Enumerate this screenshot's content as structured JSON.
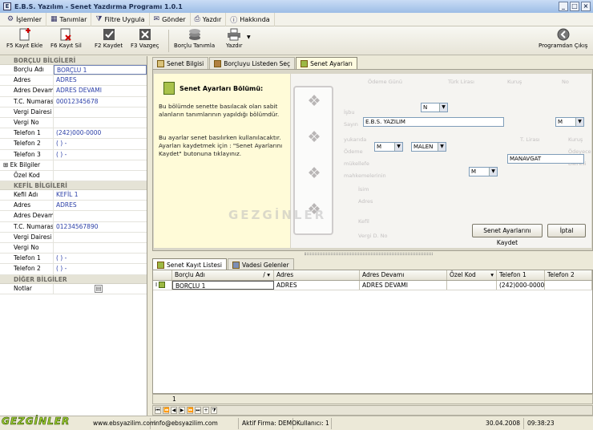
{
  "window": {
    "title": "E.B.S. Yazılım  -  Senet Yazdırma Programı 1.0.1",
    "controls": [
      "_",
      "□",
      "×"
    ]
  },
  "menu": [
    {
      "icon": "gear-icon",
      "label": "İşlemler"
    },
    {
      "icon": "grid-icon",
      "label": "Tanımlar"
    },
    {
      "icon": "filter-icon",
      "label": "Filtre Uygula"
    },
    {
      "icon": "send-icon",
      "label": "Gönder"
    },
    {
      "icon": "printer-icon",
      "label": "Yazdır"
    },
    {
      "icon": "info-icon",
      "label": "Hakkında"
    }
  ],
  "toolbar": {
    "add": "F5 Kayıt Ekle",
    "delete": "F6 Kayıt Sil",
    "save": "F2 Kaydet",
    "cancel": "F3 Vazgeç",
    "borclu": "Borçlu Tanımla",
    "print": "Yazdır",
    "exit": "Programdan Çıkış"
  },
  "left": {
    "borclu_header": "BORÇLU BİLGİLERİ",
    "borclu_rows": [
      {
        "label": "Borçlu Adı",
        "value": "BORÇLU 1"
      },
      {
        "label": "Adres",
        "value": "ADRES"
      },
      {
        "label": "Adres Devamı",
        "value": "ADRES DEVAMI"
      },
      {
        "label": "T.C. Numarası",
        "value": "00012345678"
      },
      {
        "label": "Vergi Dairesi",
        "value": ""
      },
      {
        "label": "Vergi No",
        "value": ""
      },
      {
        "label": "Telefon 1",
        "value": "(242)000-0000"
      },
      {
        "label": "Telefon 2",
        "value": "(   )   -"
      },
      {
        "label": "Telefon 3",
        "value": "(   )   -"
      },
      {
        "label": "Ek Bilgiler",
        "value": ""
      },
      {
        "label": "Özel Kod",
        "value": ""
      }
    ],
    "kefil_header": "KEFİL BİLGİLERİ",
    "kefil_rows": [
      {
        "label": "Kefil Adı",
        "value": "KEFİL 1"
      },
      {
        "label": "Adres",
        "value": "ADRES"
      },
      {
        "label": "Adres Devamı",
        "value": ""
      },
      {
        "label": "T.C. Numarası",
        "value": "01234567890"
      },
      {
        "label": "Vergi Dairesi",
        "value": ""
      },
      {
        "label": "Vergi No",
        "value": ""
      },
      {
        "label": "Telefon 1",
        "value": "(   )   -"
      },
      {
        "label": "Telefon 2",
        "value": "(   )   -"
      }
    ],
    "diger_header": "DİĞER BİLGİLER",
    "notlar_label": "Notlar"
  },
  "tabs_top": [
    "Senet Bilgisi",
    "Borçluyu Listeden Seç",
    "Senet Ayarları"
  ],
  "info": {
    "title": "Senet Ayarları Bölümü:",
    "p1": "Bu bölümde senette basılacak olan sabit alanların tanımlarının yapıldığı bölümdür.",
    "p2": "Bu ayarlar senet basılırken  kullanılacaktır. Ayarları kaydetmek için : \"Senet Ayarlarını Kaydet\" butonuna tıklayınız."
  },
  "senet": {
    "faint_headers": [
      "Ödeme Günü",
      "Türk Lirası",
      "Kuruş",
      "No"
    ],
    "faint_labels": [
      "İşbu",
      "Sayın",
      "yukarıda",
      "Ödeme",
      "mükellefe",
      "mahkemelerinin",
      "İsim",
      "Adres",
      "Kefil",
      "Vergi D. No",
      "T. Lirası",
      "Kuruş",
      "Ödeyecek",
      "Dairesi"
    ],
    "select_n": "N",
    "company": "E.B.S. YAZILIM",
    "select_m1": "M",
    "select_m2": "M",
    "malen": "MALEN",
    "manavgat": "MANAVGAT",
    "select_m3": "M",
    "save_btn": "Senet Ayarlarını Kaydet",
    "cancel_btn": "İptal"
  },
  "watermark": "GEZGİNLER",
  "tabs_bottom": [
    "Senet Kayıt Listesi",
    "Vadesi Gelenler"
  ],
  "grid": {
    "columns": [
      "Borçlu Adı",
      "Adres",
      "Adres Devamı",
      "Özel Kod",
      "Telefon 1",
      "Telefon 2"
    ],
    "rows": [
      [
        "BORÇLU 1",
        "ADRES",
        "ADRES DEVAMI",
        "",
        "(242)000-0000",
        ""
      ]
    ],
    "footer_count": "1"
  },
  "status": {
    "logo": "GEZGİNLER",
    "web": "www.ebsyazilim.com",
    "mail": "info@ebsyazilim.com",
    "firma": "Aktif Firma: DEMO",
    "kullanici": "Kullanıcı: 1",
    "date": "30.04.2008",
    "time": "09:38:23"
  }
}
